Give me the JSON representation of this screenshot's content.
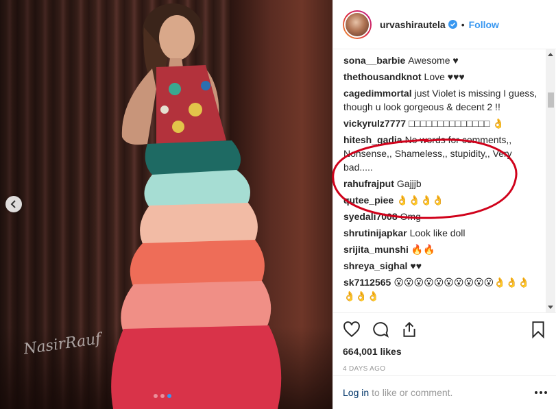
{
  "post": {
    "username": "urvashirautela",
    "follow_label": "Follow",
    "separator": "•",
    "photo_watermark": "NasirRauf",
    "likes": "664,001 likes",
    "time_ago": "4 DAYS AGO",
    "login_link": "Log in",
    "login_suffix": "to like or comment."
  },
  "comments": [
    {
      "user": "sona__barbie",
      "text": "Awesome ♥"
    },
    {
      "user": "thethousandknot",
      "text": "Love ♥♥♥"
    },
    {
      "user": "cagedimmortal",
      "text": "just Violet is missing I guess, though u look gorgeous & decent 2 !!"
    },
    {
      "user": "vickyrulz7777",
      "text": "□□□□□□□□□□□□□□ 👌"
    },
    {
      "user": "hitesh_gadia",
      "text": "No words for comments,, Nonsense,, Shameless,, stupidity,, Very bad....."
    },
    {
      "user": "rahufrajput",
      "text": "Gajjjb"
    },
    {
      "user": "qutee_piee",
      "text": "👌👌👌👌"
    },
    {
      "user": "syedali7008",
      "text": "Omg"
    },
    {
      "user": "shrutinijapkar",
      "text": "Look like doll"
    },
    {
      "user": "srijita_munshi",
      "text": "🔥🔥"
    },
    {
      "user": "shreya_sighal",
      "text": "♥♥"
    },
    {
      "user": "sk7112565",
      "text": "😮😮😮😮😮😮😮😮😮😮👌👌👌 👌👌👌"
    }
  ],
  "colors": {
    "accent": "#3897f0",
    "annotation": "#d0021b"
  }
}
